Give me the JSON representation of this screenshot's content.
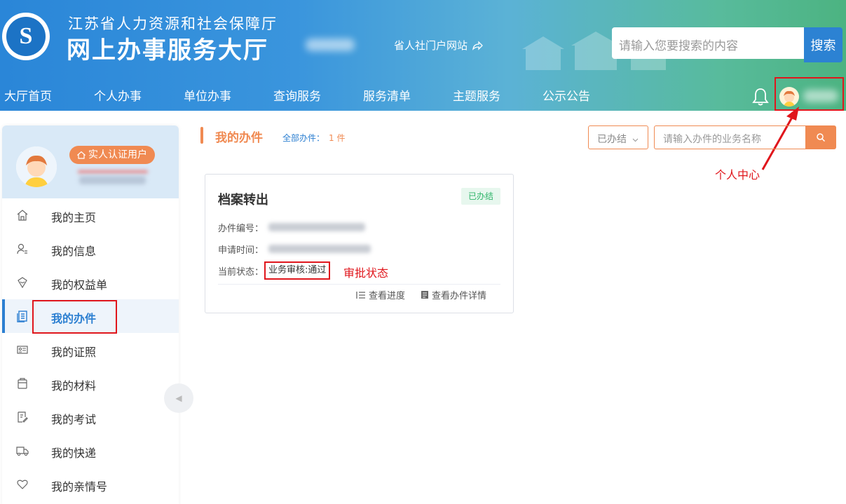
{
  "header": {
    "org_name": "江苏省人力资源和社会保障厅",
    "hall_name": "网上办事服务大厅",
    "portal_link": "省人社门户网站",
    "search_placeholder": "请输入您要搜索的内容",
    "search_button": "搜索",
    "nav": [
      "大厅首页",
      "个人办事",
      "单位办事",
      "查询服务",
      "服务清单",
      "主题服务",
      "公示公告"
    ],
    "annotation_user_center": "个人中心"
  },
  "sidebar": {
    "badge": "实人认证用户",
    "items": [
      {
        "label": "我的主页",
        "icon": "home-icon",
        "name": "my-home",
        "active": false
      },
      {
        "label": "我的信息",
        "icon": "user-info-icon",
        "name": "my-info",
        "active": false
      },
      {
        "label": "我的权益单",
        "icon": "rights-icon",
        "name": "my-rights",
        "active": false
      },
      {
        "label": "我的办件",
        "icon": "document-icon",
        "name": "my-cases",
        "active": true
      },
      {
        "label": "我的证照",
        "icon": "id-card-icon",
        "name": "my-licenses",
        "active": false
      },
      {
        "label": "我的材料",
        "icon": "folder-icon",
        "name": "my-materials",
        "active": false
      },
      {
        "label": "我的考试",
        "icon": "exam-icon",
        "name": "my-exams",
        "active": false
      },
      {
        "label": "我的快递",
        "icon": "truck-icon",
        "name": "my-express",
        "active": false
      },
      {
        "label": "我的亲情号",
        "icon": "heart-icon",
        "name": "my-family",
        "active": false
      }
    ]
  },
  "main": {
    "title": "我的办件",
    "count_label": "全部办件：",
    "count_value": "1 件",
    "filter_select": "已办结",
    "filter_placeholder": "请输入办件的业务名称",
    "card": {
      "title": "档案转出",
      "status": "已办结",
      "case_no_label": "办件编号：",
      "apply_time_label": "申请时间：",
      "state_label": "当前状态：",
      "state_value": "业务审核:通过",
      "action_progress": "查看进度",
      "action_detail": "查看办件详情"
    },
    "annotation_state": "审批状态"
  },
  "colors": {
    "accent_orange": "#f08a52",
    "primary_blue": "#2c7fd1",
    "annotation_red": "#e0161c",
    "status_green": "#2fb56a"
  }
}
